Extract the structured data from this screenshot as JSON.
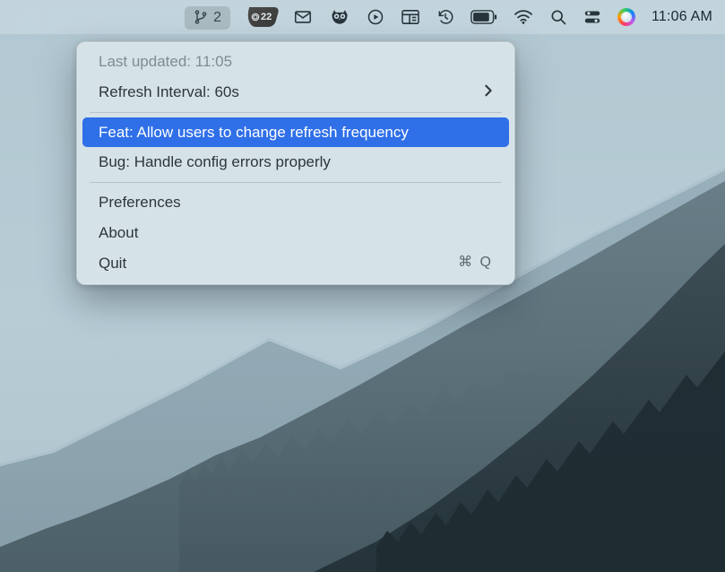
{
  "menubar": {
    "git_count": "2",
    "badge_count": "22",
    "clock": "11:06 AM",
    "icons": {
      "git": "git-branch-icon",
      "wallet": "wallet-badge-icon",
      "mail": "mail-icon",
      "owl": "owl-icon",
      "play": "play-circle-icon",
      "window": "window-layout-icon",
      "timemachine": "time-machine-icon",
      "battery": "battery-icon",
      "wifi": "wifi-icon",
      "search": "search-icon",
      "control": "control-center-icon",
      "siri": "siri-icon"
    }
  },
  "dropdown": {
    "last_updated": "Last updated: 11:05",
    "refresh_interval": "Refresh Interval: 60s",
    "items": [
      "Feat: Allow users to change refresh frequency",
      "Bug: Handle config errors properly"
    ],
    "preferences": "Preferences",
    "about": "About",
    "quit": "Quit",
    "quit_shortcut": "⌘ Q"
  }
}
